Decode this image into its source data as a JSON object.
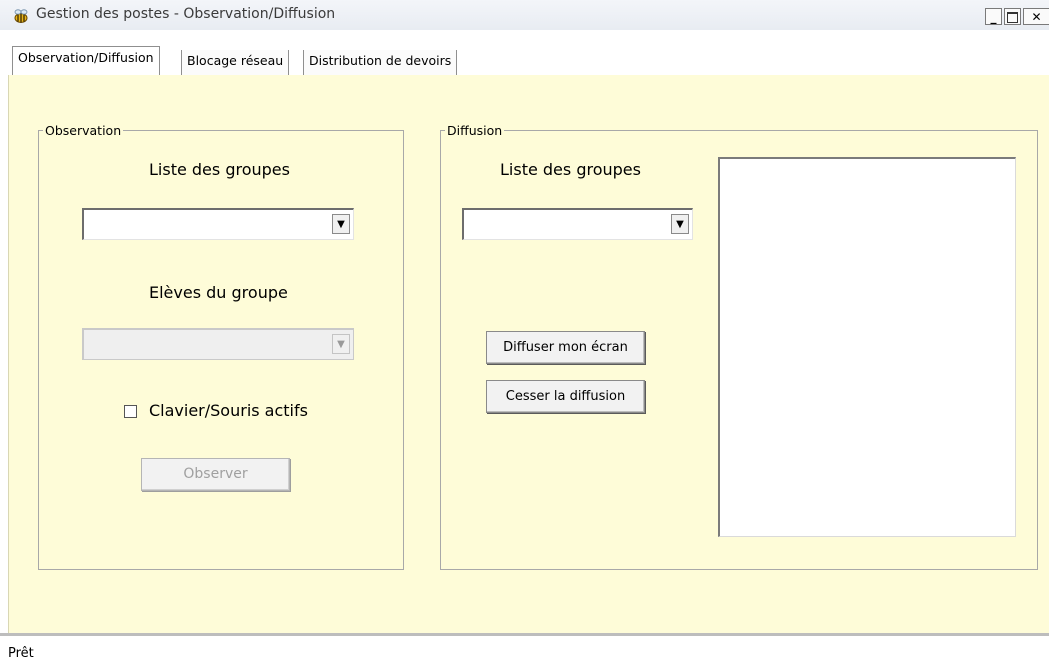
{
  "window": {
    "title": "Gestion des postes - Observation/Diffusion",
    "minimize_glyph": "_",
    "close_glyph": "✕",
    "app_icon": "bee-icon"
  },
  "tabs": [
    {
      "label": "Observation/Diffusion",
      "active": true
    },
    {
      "label": "Blocage réseau",
      "active": false
    },
    {
      "label": "Distribution de devoirs",
      "active": false
    }
  ],
  "observation": {
    "legend": "Observation",
    "groups_label": "Liste des groupes",
    "groups_value": "",
    "students_label": "Elèves du groupe",
    "students_value": "",
    "checkbox_label": "Clavier/Souris actifs",
    "checkbox_checked": false,
    "observe_button": "Observer"
  },
  "diffusion": {
    "legend": "Diffusion",
    "groups_label": "Liste des groupes",
    "groups_value": "",
    "broadcast_button": "Diffuser mon écran",
    "stop_button": "Cesser la diffusion"
  },
  "status": {
    "text": "Prêt"
  },
  "colors": {
    "panel_background": "#fefcd8",
    "titlebar": "#eef1f6"
  }
}
